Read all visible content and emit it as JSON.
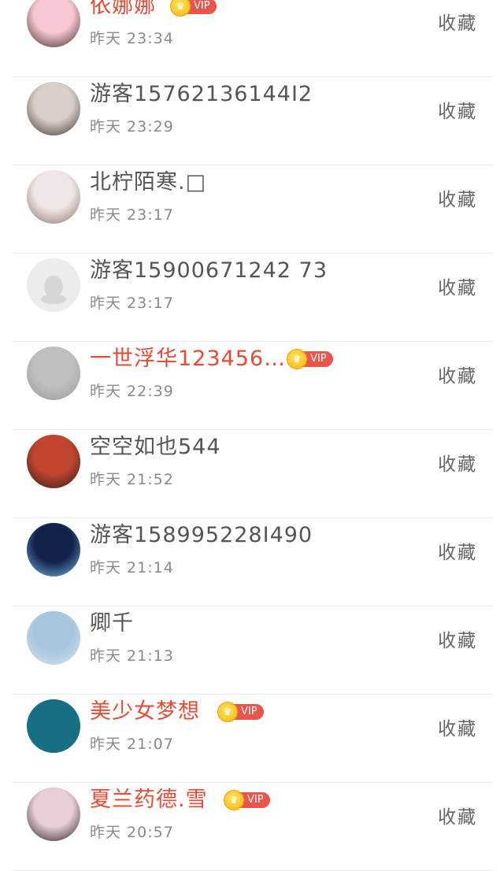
{
  "rows": [
    {
      "name": "依娜娜",
      "vip": true,
      "time": "昨天 23:34",
      "action": "收藏",
      "avatar_colors": [
        "#f7c7d3",
        "#3a2a25"
      ]
    },
    {
      "name": "游客15762136144I2",
      "vip": false,
      "time": "昨天 23:29",
      "action": "收藏",
      "avatar_colors": [
        "#d9cfc6",
        "#3b302a"
      ]
    },
    {
      "name": "北柠陌寒.□",
      "vip": false,
      "time": "昨天 23:17",
      "action": "收藏",
      "avatar_colors": [
        "#efe6e6",
        "#8a6e66"
      ]
    },
    {
      "name": "游客15900671242 73",
      "vip": false,
      "time": "昨天 23:17",
      "action": "收藏",
      "avatar_colors": [
        "#ececec",
        "#dcdcdc"
      ]
    },
    {
      "name": "一世浮华123456…",
      "vip": true,
      "time": "昨天 22:39",
      "action": "收藏",
      "avatar_colors": [
        "#bfbfbf",
        "#9a9a9a"
      ]
    },
    {
      "name": "空空如也544",
      "vip": false,
      "time": "昨天 21:52",
      "action": "收藏",
      "avatar_colors": [
        "#c2452f",
        "#2c1e1a"
      ]
    },
    {
      "name": "游客158995228I490",
      "vip": false,
      "time": "昨天 21:14",
      "action": "收藏",
      "avatar_colors": [
        "#12224b",
        "#7ab6e8"
      ]
    },
    {
      "name": "卿千",
      "vip": false,
      "time": "昨天 21:13",
      "action": "收藏",
      "avatar_colors": [
        "#a7c6dd",
        "#d6e4ee"
      ]
    },
    {
      "name": "美少女梦想",
      "vip": true,
      "time": "昨天 21:07",
      "action": "收藏",
      "avatar_colors": [
        "#166f82",
        "#166f82"
      ]
    },
    {
      "name": "夏兰药德.雪",
      "vip": true,
      "time": "昨天 20:57",
      "action": "收藏",
      "avatar_colors": [
        "#e7cfd4",
        "#2a1c22"
      ]
    }
  ],
  "vip_label": "VIP",
  "vip_crown_glyph": "♛"
}
